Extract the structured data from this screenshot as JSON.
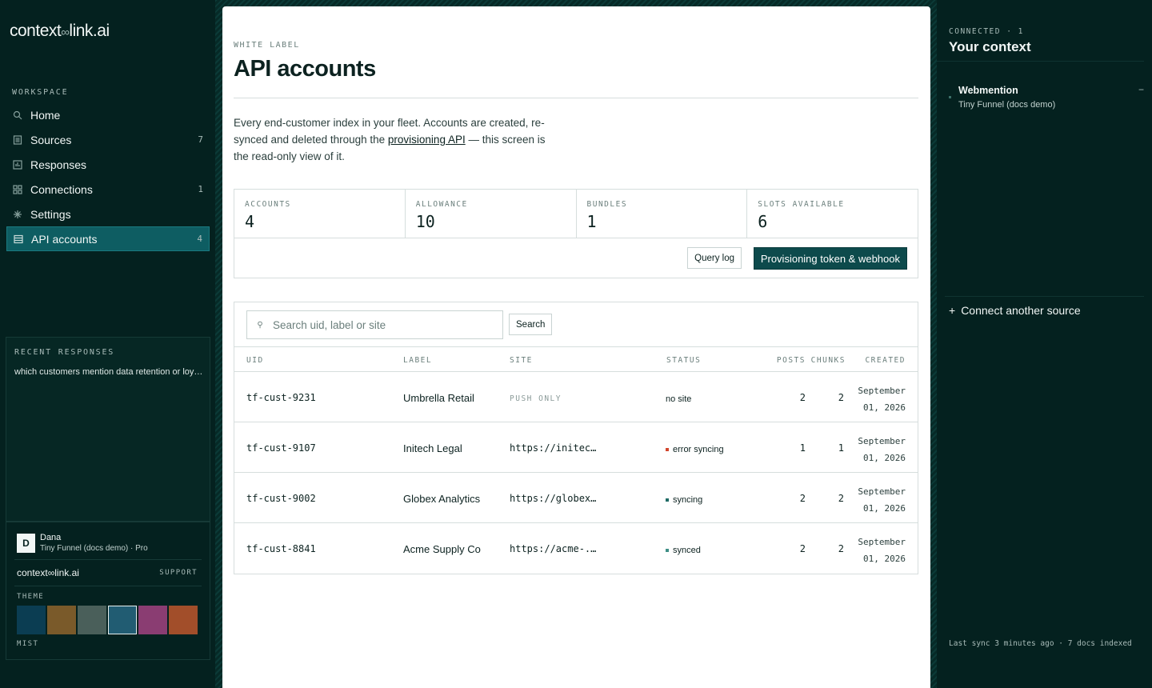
{
  "sidebar": {
    "logo_left": "context",
    "logo_link": "∞",
    "logo_right": "link.ai",
    "workspace_label": "WORKSPACE",
    "items": [
      {
        "label": "Home",
        "count": ""
      },
      {
        "label": "Sources",
        "count": "7"
      },
      {
        "label": "Responses",
        "count": ""
      },
      {
        "label": "Connections",
        "count": "1"
      },
      {
        "label": "Settings",
        "count": ""
      },
      {
        "label": "API accounts",
        "count": "4"
      }
    ],
    "recent_title": "RECENT RESPONSES",
    "recent_items": [
      "which customers mention data retention or loyalty"
    ],
    "user": {
      "initial": "D",
      "name": "Dana",
      "org": "Tiny Funnel (docs demo) · Pro"
    },
    "footer_logo": "context∞link.ai",
    "support": "SUPPORT",
    "theme_label": "THEME",
    "theme_name": "MIST",
    "swatches": [
      "#0b3d52",
      "#7a5a2a",
      "#4a5f5a",
      "#215c72",
      "#8a3d72",
      "#a24e2a"
    ]
  },
  "main": {
    "eyebrow": "WHITE LABEL",
    "title": "API accounts",
    "intro_before": "Every end-customer index in your fleet. Accounts are created, re-synced and deleted through the ",
    "intro_link": "provisioning API",
    "intro_after": " — this screen is the read-only view of it.",
    "stats": [
      {
        "label": "ACCOUNTS",
        "value": "4"
      },
      {
        "label": "ALLOWANCE",
        "value": "10"
      },
      {
        "label": "BUNDLES",
        "value": "1"
      },
      {
        "label": "SLOTS AVAILABLE",
        "value": "6"
      }
    ],
    "query_log": "Query log",
    "provisioning": "Provisioning token & webhook",
    "search_placeholder": "Search uid, label or site",
    "search_button": "Search",
    "columns": {
      "uid": "UID",
      "label": "LABEL",
      "site": "SITE",
      "status": "STATUS",
      "posts": "POSTS",
      "chunks": "CHUNKS",
      "created": "CREATED"
    },
    "rows": [
      {
        "uid": "tf-cust-9231",
        "label": "Umbrella Retail",
        "site": "PUSH ONLY",
        "status": "no site",
        "posts": "2",
        "chunks": "2",
        "created_1": "September",
        "created_2": "01, 2026"
      },
      {
        "uid": "tf-cust-9107",
        "label": "Initech Legal",
        "site": "https://initech-...",
        "status": "error syncing",
        "posts": "1",
        "chunks": "1",
        "created_1": "September",
        "created_2": "01, 2026"
      },
      {
        "uid": "tf-cust-9002",
        "label": "Globex Analytics",
        "site": "https://globex-...",
        "status": "syncing",
        "posts": "2",
        "chunks": "2",
        "created_1": "September",
        "created_2": "01, 2026"
      },
      {
        "uid": "tf-cust-8841",
        "label": "Acme Supply Co",
        "site": "https://acme-...",
        "status": "synced",
        "posts": "2",
        "chunks": "2",
        "created_1": "September",
        "created_2": "01, 2026"
      }
    ],
    "status_colors": {
      "no site": "",
      "error syncing": "#d2462d",
      "syncing": "#1f6b66",
      "synced": "#3f8f86"
    }
  },
  "right": {
    "connected_label": "CONNECTED · 1",
    "title": "Your context",
    "source_name": "Webmention",
    "source_sub": "Tiny Funnel (docs demo)",
    "remove": "−",
    "connect": "Connect another source",
    "connect_plus": "+",
    "last_sync": "Last sync 3 minutes ago · 7 docs indexed"
  }
}
